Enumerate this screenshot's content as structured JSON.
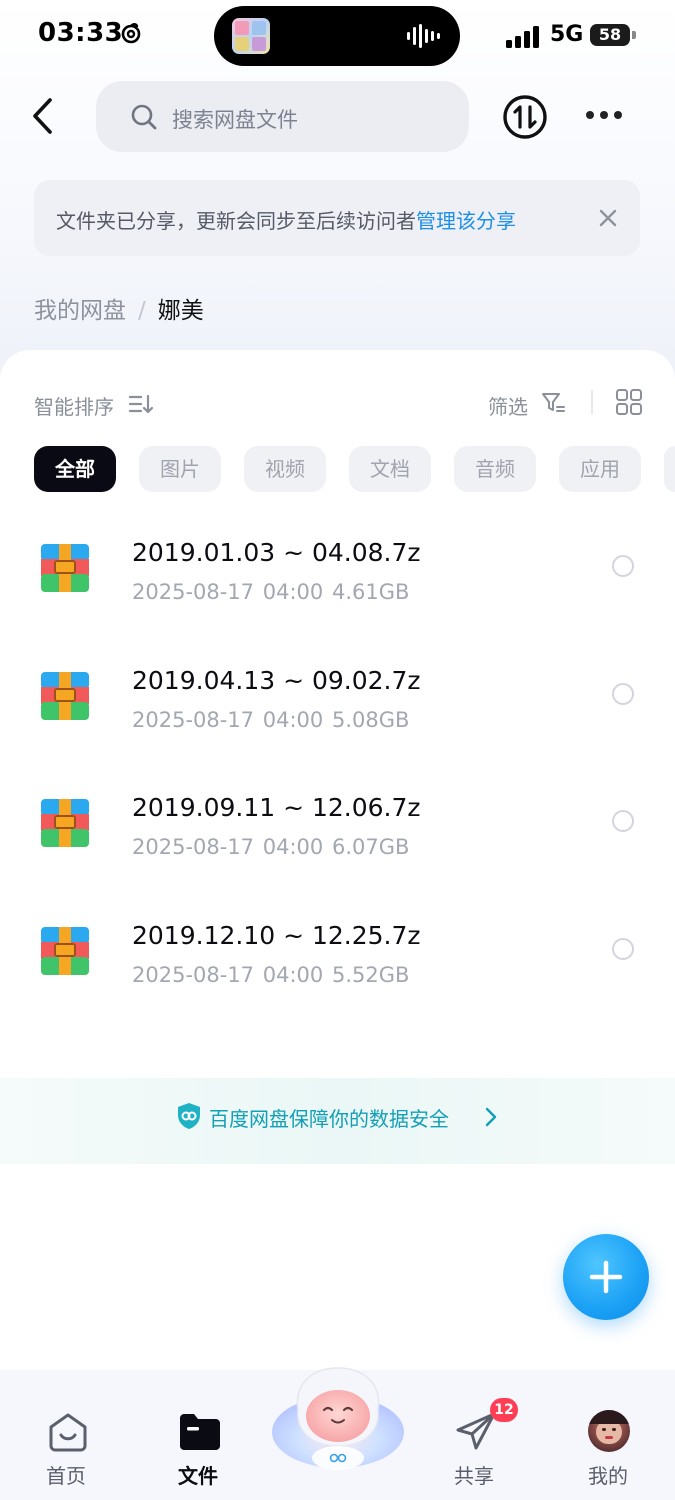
{
  "status_bar": {
    "time": "03:33",
    "network": "5G",
    "battery": "58"
  },
  "header": {
    "search_placeholder": "搜索网盘文件"
  },
  "notice": {
    "text": "文件夹已分享，更新会同步至后续访问者",
    "link": "管理该分享"
  },
  "breadcrumb": {
    "root": "我的网盘",
    "separator": "/",
    "current": "娜美"
  },
  "toolbar": {
    "sort_label": "智能排序",
    "filter_label": "筛选"
  },
  "filter_chips": [
    {
      "label": "全部",
      "active": true
    },
    {
      "label": "图片",
      "active": false
    },
    {
      "label": "视频",
      "active": false
    },
    {
      "label": "文档",
      "active": false
    },
    {
      "label": "音频",
      "active": false
    },
    {
      "label": "应用",
      "active": false
    }
  ],
  "files": [
    {
      "name": "2019.01.03 ~ 04.08.7z",
      "date": "2025-08-17",
      "time": "04:00",
      "size": "4.61GB"
    },
    {
      "name": "2019.04.13 ~ 09.02.7z",
      "date": "2025-08-17",
      "time": "04:00",
      "size": "5.08GB"
    },
    {
      "name": "2019.09.11 ~ 12.06.7z",
      "date": "2025-08-17",
      "time": "04:00",
      "size": "6.07GB"
    },
    {
      "name": "2019.12.10 ~ 12.25.7z",
      "date": "2025-08-17",
      "time": "04:00",
      "size": "5.52GB"
    }
  ],
  "security_banner": {
    "text": "百度网盘保障你的数据安全"
  },
  "bottom_nav": {
    "home": "首页",
    "files": "文件",
    "share": "共享",
    "share_badge": "12",
    "mine": "我的"
  },
  "colors": {
    "accent_link": "#1e8fe6",
    "security_teal": "#139fb5",
    "fab_blue": "#1aa0f5",
    "badge_red": "#ff3e56",
    "chip_active": "#0a0a14"
  },
  "icons": {
    "back": "chevron-left-icon",
    "search": "search-icon",
    "transfer": "transfer-icon",
    "more": "more-icon",
    "close": "close-icon",
    "sort": "sort-icon",
    "filter": "filter-icon",
    "grid": "grid-view-icon",
    "archive": "archive-file-icon",
    "shield": "shield-icon",
    "plus": "plus-icon"
  }
}
